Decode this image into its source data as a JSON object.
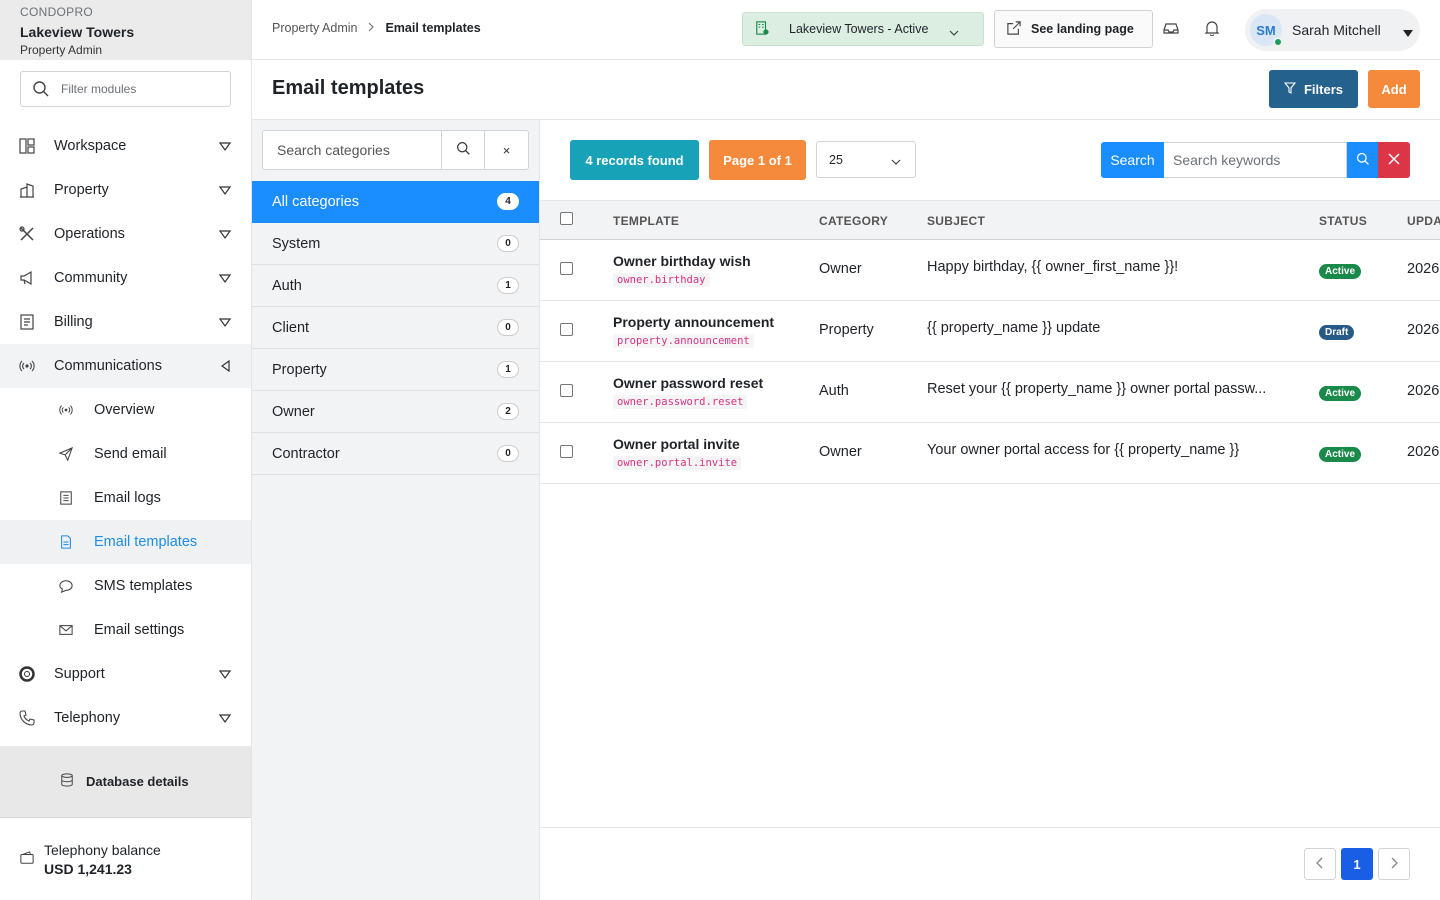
{
  "brand": {
    "sup": "CONDOPRO",
    "name": "Lakeview Towers",
    "role": "Property Admin"
  },
  "sidebar": {
    "filter_placeholder": "Filter modules",
    "items": [
      {
        "label": "Workspace",
        "icon": "layout-icon"
      },
      {
        "label": "Property",
        "icon": "building-icon"
      },
      {
        "label": "Operations",
        "icon": "tools-icon"
      },
      {
        "label": "Community",
        "icon": "megaphone-icon"
      },
      {
        "label": "Billing",
        "icon": "invoice-icon"
      },
      {
        "label": "Communications",
        "icon": "broadcast-icon"
      }
    ],
    "sub_items": [
      {
        "label": "Overview",
        "icon": "broadcast-icon"
      },
      {
        "label": "Send email",
        "icon": "send-icon"
      },
      {
        "label": "Email logs",
        "icon": "log-icon"
      },
      {
        "label": "Email templates",
        "icon": "document-icon"
      },
      {
        "label": "SMS templates",
        "icon": "chat-icon"
      },
      {
        "label": "Email settings",
        "icon": "mail-settings-icon"
      }
    ],
    "bottom_items": [
      {
        "label": "Support",
        "icon": "lifebuoy-icon"
      },
      {
        "label": "Telephony",
        "icon": "phone-icon"
      }
    ],
    "database_label": "Database details",
    "balance_label": "Telephony balance",
    "balance_value": "USD 1,241.23"
  },
  "topbar": {
    "breadcrumb_parent": "Property Admin",
    "breadcrumb_current": "Email templates",
    "property_select": "Lakeview Towers - Active",
    "landing_label": "See landing page",
    "user_initials": "SM",
    "user_name": "Sarah Mitchell"
  },
  "page": {
    "title": "Email templates",
    "filters_label": "Filters",
    "add_label": "Add"
  },
  "categories": {
    "search_placeholder": "Search categories",
    "clear": "×",
    "items": [
      {
        "label": "All categories",
        "count": "4"
      },
      {
        "label": "System",
        "count": "0"
      },
      {
        "label": "Auth",
        "count": "1"
      },
      {
        "label": "Client",
        "count": "0"
      },
      {
        "label": "Property",
        "count": "1"
      },
      {
        "label": "Owner",
        "count": "2"
      },
      {
        "label": "Contractor",
        "count": "0"
      }
    ]
  },
  "toolbar": {
    "records": "4 records found",
    "page_info": "Page 1 of 1",
    "per_page": "25",
    "search_label": "Search",
    "search_placeholder": "Search keywords"
  },
  "table": {
    "headers": {
      "template": "TEMPLATE",
      "category": "CATEGORY",
      "subject": "SUBJECT",
      "status": "STATUS",
      "updated": "UPDA"
    },
    "rows": [
      {
        "name": "Owner birthday wish",
        "code": "owner.birthday",
        "category": "Owner",
        "subject": "Happy birthday, {{ owner_first_name }}!",
        "status": "Active",
        "updated": "2026"
      },
      {
        "name": "Property announcement",
        "code": "property.announcement",
        "category": "Property",
        "subject": "{{ property_name }} update",
        "status": "Draft",
        "updated": "2026"
      },
      {
        "name": "Owner password reset",
        "code": "owner.password.reset",
        "category": "Auth",
        "subject": "Reset your {{ property_name }} owner portal passw...",
        "status": "Active",
        "updated": "2026"
      },
      {
        "name": "Owner portal invite",
        "code": "owner.portal.invite",
        "category": "Owner",
        "subject": "Your owner portal access for {{ property_name }}",
        "status": "Active",
        "updated": "2026"
      }
    ]
  },
  "pagination": {
    "current": "1"
  },
  "colors": {
    "accent": "#1a8dff",
    "primary_dark": "#25618d",
    "orange": "#f58a3c",
    "teal": "#17a2b8",
    "active_badge": "#1a8a4a",
    "draft_badge": "#275a86"
  }
}
